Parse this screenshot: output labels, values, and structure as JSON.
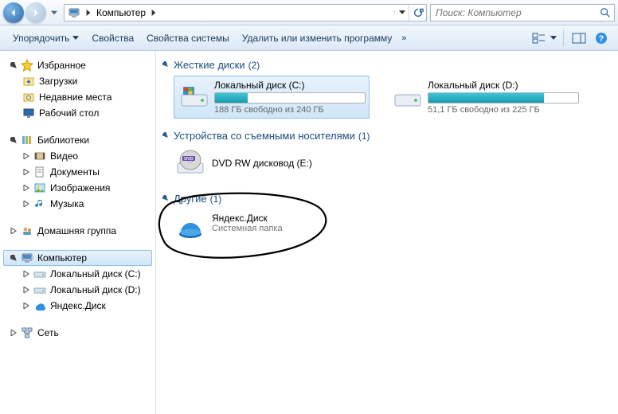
{
  "nav": {
    "breadcrumb_root": "Компьютер",
    "search_placeholder": "Поиск: Компьютер"
  },
  "toolbar": {
    "organize": "Упорядочить",
    "properties": "Свойства",
    "sys_properties": "Свойства системы",
    "uninstall": "Удалить или изменить программу"
  },
  "sidebar": {
    "favorites": {
      "title": "Избранное",
      "items": [
        "Загрузки",
        "Недавние места",
        "Рабочий стол"
      ]
    },
    "libraries": {
      "title": "Библиотеки",
      "items": [
        "Видео",
        "Документы",
        "Изображения",
        "Музыка"
      ]
    },
    "homegroup": {
      "title": "Домашняя группа"
    },
    "computer": {
      "title": "Компьютер",
      "items": [
        "Локальный диск (C:)",
        "Локальный диск (D:)",
        "Яндекс.Диск"
      ]
    },
    "network": {
      "title": "Сеть"
    }
  },
  "sections": {
    "hdd": {
      "title": "Жесткие диски",
      "count": "(2)"
    },
    "removable": {
      "title": "Устройства со съемными носителями",
      "count": "(1)"
    },
    "other": {
      "title": "Другие",
      "count": "(1)"
    }
  },
  "drives": {
    "c": {
      "name": "Локальный диск (C:)",
      "free": "188 ГБ свободно из 240 ГБ",
      "fill_pct": 22
    },
    "d": {
      "name": "Локальный диск (D:)",
      "free": "51,1 ГБ свободно из 225 ГБ",
      "fill_pct": 77
    }
  },
  "dvd": {
    "name": "DVD RW дисковод (E:)"
  },
  "yadisk": {
    "name": "Яндекс.Диск",
    "sub": "Системная папка"
  }
}
